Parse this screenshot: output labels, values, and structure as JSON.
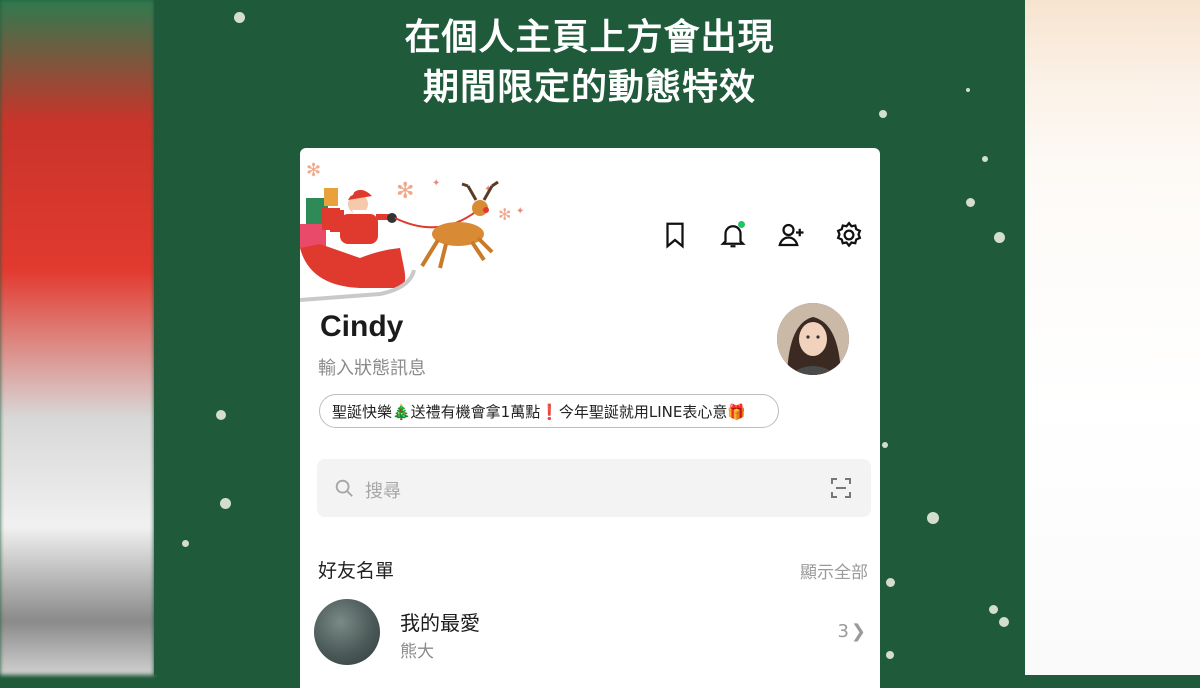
{
  "headline": {
    "line1": "在個人主頁上方會出現",
    "line2": "期間限定的動態特效"
  },
  "profile": {
    "name": "Cindy",
    "status_placeholder": "輸入狀態訊息",
    "banner_text": "聖誕快樂🎄送禮有機會拿1萬點❗今年聖誕就用LINE表心意🎁"
  },
  "top_icons": [
    "bookmark-icon",
    "bell-icon",
    "add-friend-icon",
    "gear-icon"
  ],
  "search": {
    "placeholder": "搜尋"
  },
  "friends": {
    "title": "好友名單",
    "show_all": "顯示全部",
    "favorites": {
      "label": "我的最愛",
      "sub": "熊大",
      "count": "3"
    }
  },
  "colors": {
    "background_green": "#1f5b3a",
    "notification_dot": "#23c464",
    "sleigh_red": "#e03a2e"
  }
}
